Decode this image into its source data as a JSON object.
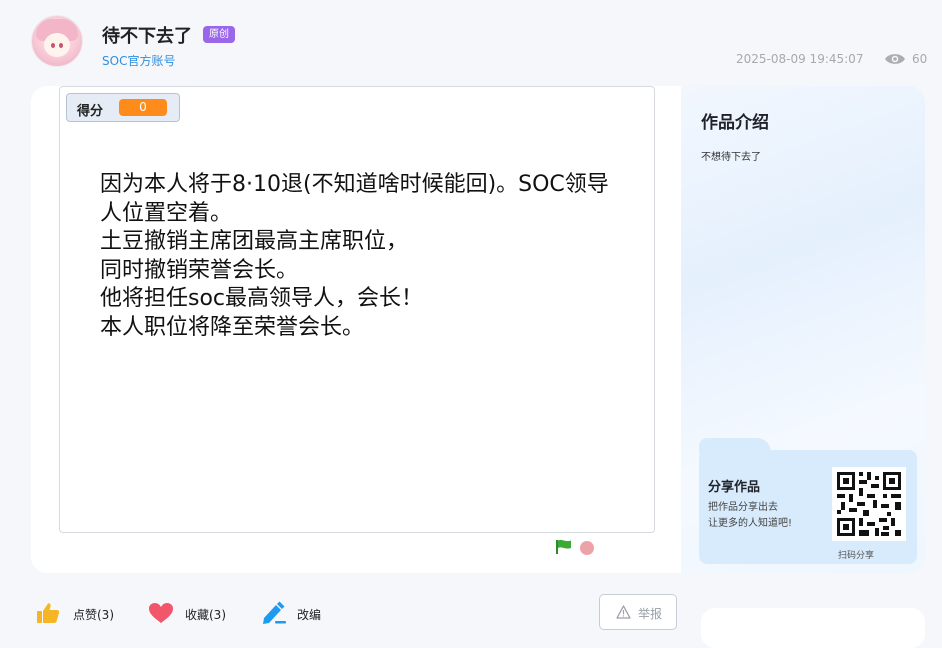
{
  "header": {
    "title": "待不下去了",
    "badge": "原创",
    "author": "SOC官方账号",
    "timestamp": "2025-08-09 19:45:07",
    "views": "60"
  },
  "stage": {
    "score_label": "得分",
    "score_value": "0",
    "text": "因为本人将于8·10退(不知道啥时候能回)。SOC领导\n人位置空着。\n土豆撤销主席团最高主席职位，\n同时撤销荣誉会长。\n他将担任soc最高领导人，会长！\n本人职位将降至荣誉会长。"
  },
  "info": {
    "title": "作品介绍",
    "description": "不想待下去了"
  },
  "share": {
    "title": "分享作品",
    "line1": "把作品分享出去",
    "line2": "让更多的人知道吧!",
    "qr_caption": "扫码分享"
  },
  "actions": {
    "like": "点赞(3)",
    "favorite": "收藏(3)",
    "remix": "改编",
    "report": "举报"
  },
  "colors": {
    "accent_blue": "#2f8fe0",
    "badge_purple": "#9a67ea",
    "score_orange": "#ff8c1a",
    "like_yellow": "#f5b524",
    "favorite_pink": "#f2566b",
    "remix_blue": "#1e9af0",
    "flag_green": "#3aaa35"
  },
  "icons": [
    "avatar",
    "eye-icon",
    "green-flag-icon",
    "stop-icon",
    "thumbs-up-icon",
    "heart-icon",
    "pencil-icon",
    "warning-icon",
    "qr-code"
  ]
}
